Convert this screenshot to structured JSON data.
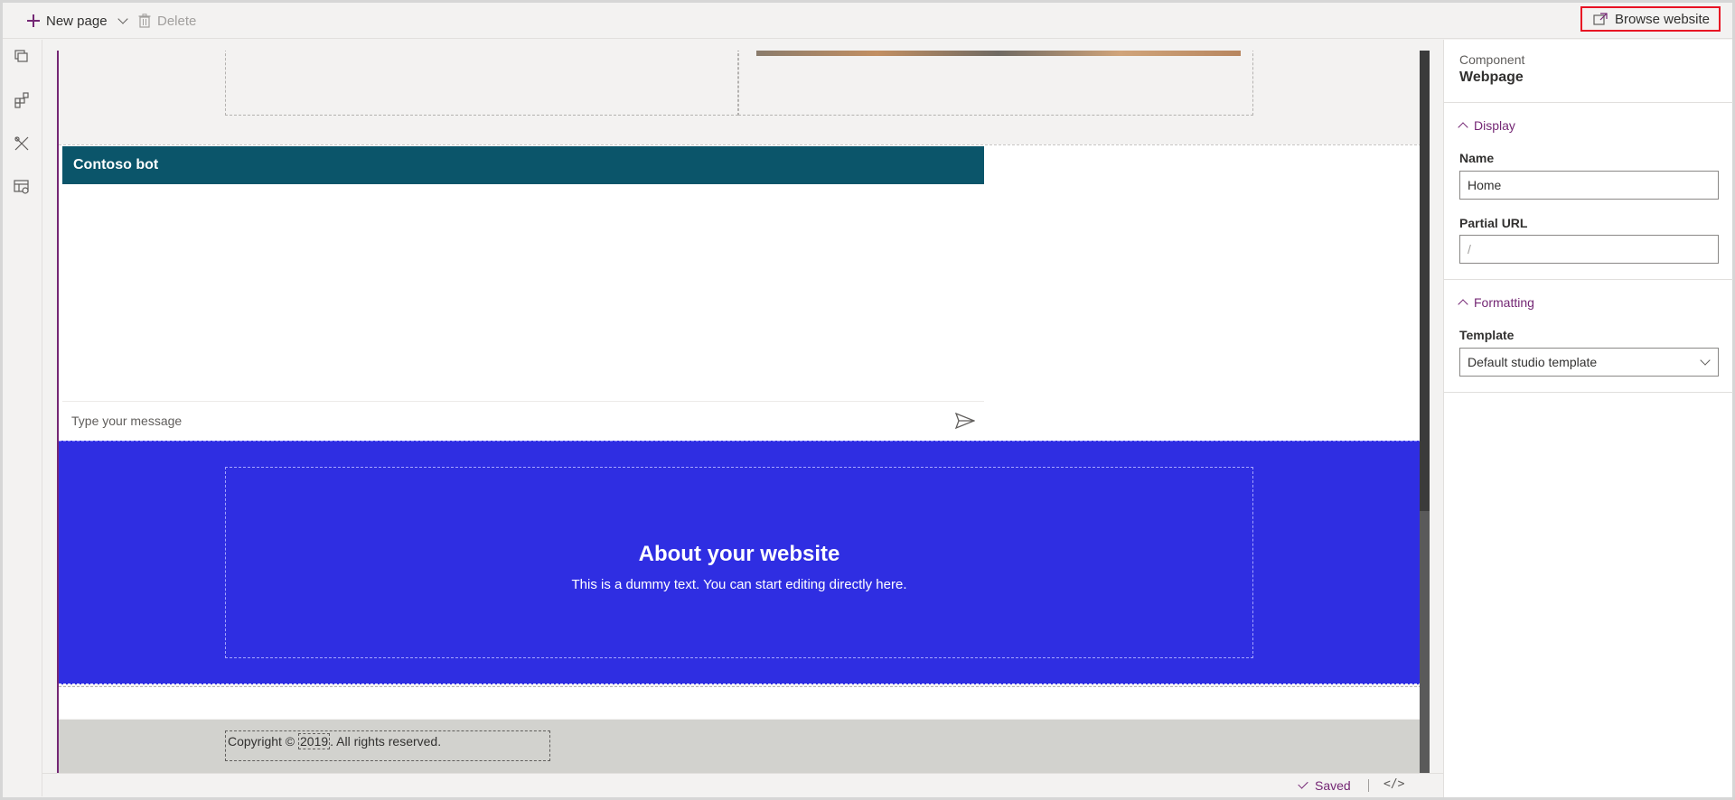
{
  "toolbar": {
    "new_page_label": "New page",
    "delete_label": "Delete",
    "browse_website_label": "Browse website"
  },
  "rail": {
    "icons": [
      "pages-icon",
      "components-icon",
      "themes-icon",
      "templates-icon"
    ]
  },
  "canvas": {
    "bot": {
      "title": "Contoso bot",
      "input_placeholder": "Type your message"
    },
    "about": {
      "title": "About your website",
      "text": "This is a dummy text. You can start editing directly here."
    },
    "footer": {
      "copyright_prefix": "Copyright © ",
      "year": "2019",
      "copyright_suffix": ". All rights reserved."
    }
  },
  "status": {
    "saved_label": "Saved",
    "code_label": "</>"
  },
  "pane": {
    "kicker": "Component",
    "title": "Webpage",
    "display_section": "Display",
    "name_label": "Name",
    "name_value": "Home",
    "partial_url_label": "Partial URL",
    "partial_url_placeholder": "/",
    "formatting_section": "Formatting",
    "template_label": "Template",
    "template_value": "Default studio template"
  },
  "colors": {
    "accent": "#742774",
    "bot_header": "#0b556a",
    "about_bg": "#2f2ee2",
    "footer_bg": "#d2d2ce",
    "highlight": "#e81123"
  }
}
